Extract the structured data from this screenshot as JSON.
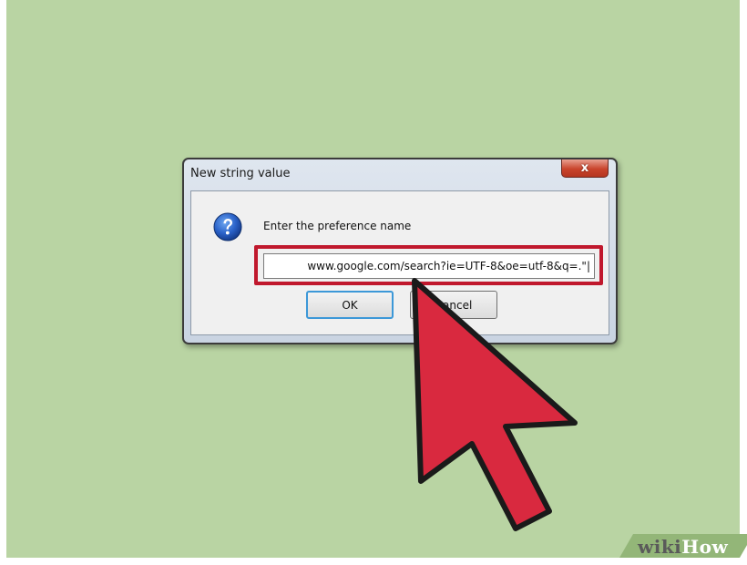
{
  "dialog": {
    "title": "New string value",
    "close_label": "x",
    "prompt": "Enter the preference name",
    "input_value": "www.google.com/search?ie=UTF-8&oe=utf-8&q=.\"|",
    "ok_label": "OK",
    "cancel_label": "Cancel"
  },
  "icons": {
    "question": "question-icon",
    "cursor": "arrow-cursor-icon"
  },
  "watermark": {
    "wiki": "wiki",
    "how": "How"
  },
  "colors": {
    "background": "#b9d4a3",
    "highlight": "#c0182d",
    "cursor": "#d9293f",
    "ok_focus": "#3c98d8"
  }
}
